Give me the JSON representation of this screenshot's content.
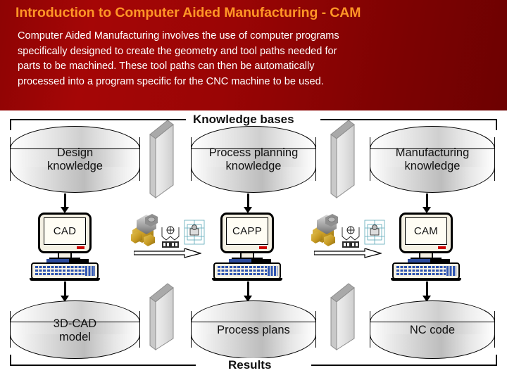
{
  "header": {
    "title": "Introduction to Computer Aided Manufacturing - CAM",
    "body_lines": [
      "Computer Aided Manufacturing involves the use of computer programs",
      "specifically designed to create the geometry and tool paths needed for",
      "parts to be machined. These tool paths can then be automatically",
      "processed into a program specific for the CNC machine to be used."
    ],
    "title_color": "#ff9526",
    "background_color": "#9a0505",
    "text_color": "#ffffff"
  },
  "diagram": {
    "sections": {
      "top_label": "Knowledge bases",
      "bottom_label": "Results"
    },
    "knowledge_bases": [
      {
        "label_line1": "Design",
        "label_line2": "knowledge"
      },
      {
        "label_line1": "Process planning",
        "label_line2": "knowledge"
      },
      {
        "label_line1": "Manufacturing",
        "label_line2": "knowledge"
      }
    ],
    "systems": [
      {
        "screen_label": "CAD"
      },
      {
        "screen_label": "CAPP"
      },
      {
        "screen_label": "CAM"
      }
    ],
    "results": [
      {
        "label_line1": "3D-CAD",
        "label_line2": "model"
      },
      {
        "label_line1": "Process plans",
        "label_line2": ""
      },
      {
        "label_line1": "NC code",
        "label_line2": ""
      }
    ],
    "part_icons": [
      {
        "name": "machined-part-3d-render"
      },
      {
        "name": "machined-part-3d-render"
      }
    ]
  }
}
